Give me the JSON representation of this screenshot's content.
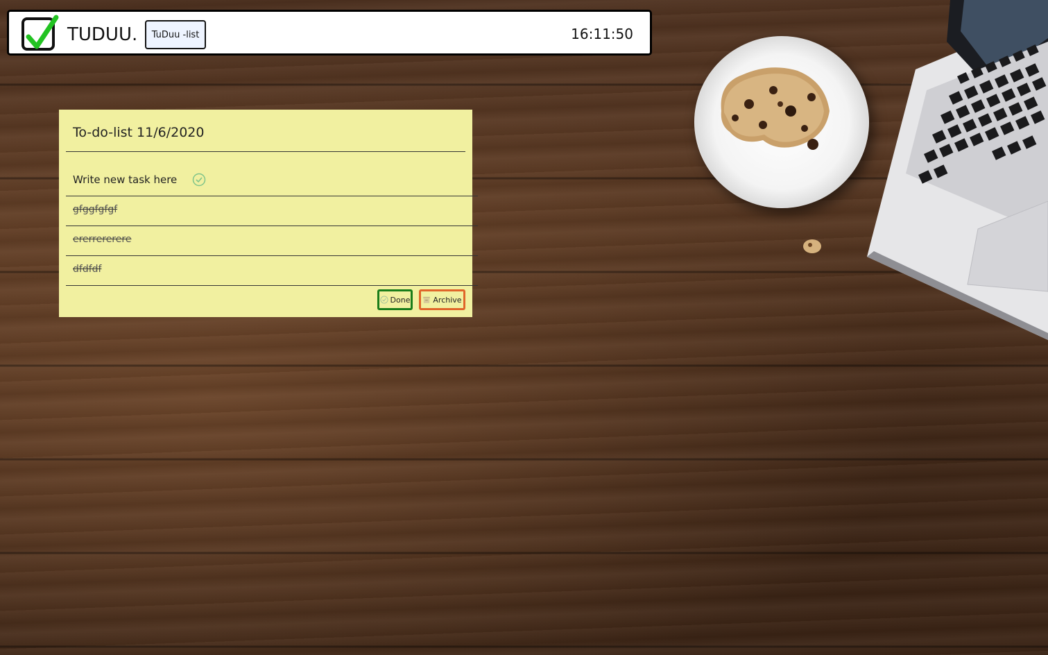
{
  "header": {
    "brand": "TUDUU.",
    "nav_button_label": "TuDuu -list",
    "clock": "16:11:50"
  },
  "todo": {
    "title": "To-do-list 11/6/2020",
    "new_task_placeholder": "Write new task here",
    "tasks": [
      {
        "text": "gfggfgfgf",
        "done": true
      },
      {
        "text": "ererrererere",
        "done": true
      },
      {
        "text": "dfdfdf",
        "done": true
      }
    ],
    "done_label": "Done",
    "archive_label": "Archive"
  },
  "colors": {
    "note_background": "#f1f0a0",
    "done_border": "#1a7d1a",
    "archive_border": "#e0662a",
    "check_green": "#22c322"
  },
  "icons": {
    "logo": "checkbox-check-icon",
    "add_task": "check-circle-icon",
    "done": "check-circle-icon",
    "archive": "archive-box-icon"
  }
}
